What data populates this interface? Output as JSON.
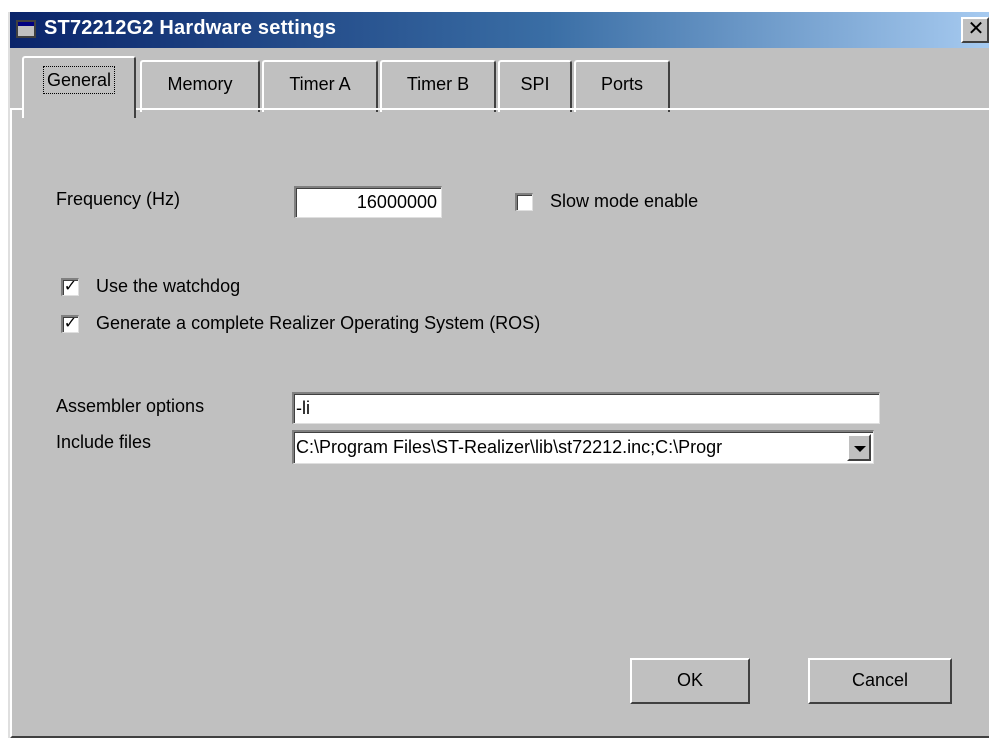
{
  "window": {
    "title": "ST72212G2 Hardware settings",
    "close_glyph": "✕"
  },
  "tabs": [
    {
      "label": "General",
      "active": true
    },
    {
      "label": "Memory",
      "active": false
    },
    {
      "label": "Timer A",
      "active": false
    },
    {
      "label": "Timer B",
      "active": false
    },
    {
      "label": "SPI",
      "active": false
    },
    {
      "label": "Ports",
      "active": false
    }
  ],
  "general": {
    "frequency_label": "Frequency (Hz)",
    "frequency_value": "16000000",
    "slow_mode_label": "Slow mode enable",
    "slow_mode_checked": false,
    "watchdog_label": "Use the watchdog",
    "watchdog_checked": true,
    "ros_label": "Generate a complete Realizer Operating System (ROS)",
    "ros_checked": true,
    "assembler_label": "Assembler options",
    "assembler_value": "-li",
    "include_label": "Include files",
    "include_value": "C:\\Program Files\\ST-Realizer\\lib\\st72212.inc;C:\\Progr"
  },
  "buttons": {
    "ok_label": "OK",
    "cancel_label": "Cancel"
  },
  "icons": {
    "title": "window-app-icon",
    "close": "close-icon",
    "dropdown": "chevron-down-icon",
    "check": "checkmark-icon"
  },
  "colors": {
    "titlebar_start": "#0a246a",
    "titlebar_end": "#a6caf0",
    "dialog_face": "#c0c0c0"
  }
}
